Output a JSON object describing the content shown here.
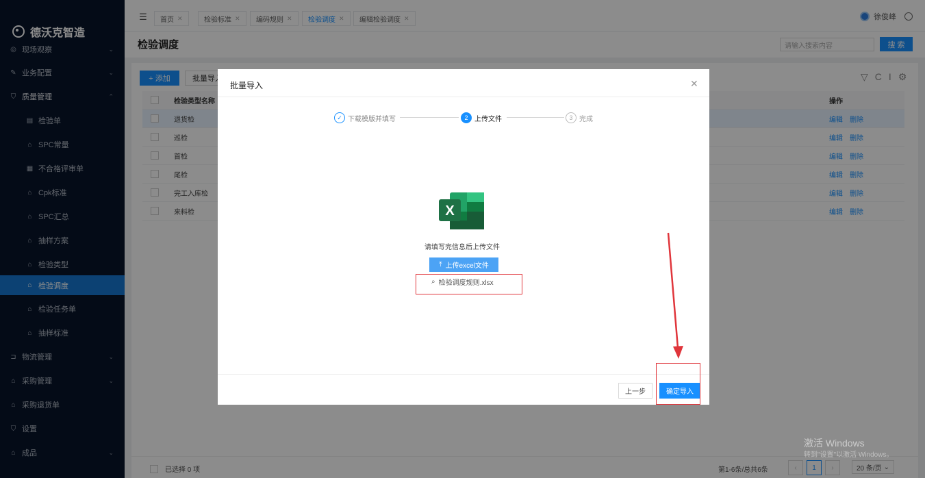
{
  "app": {
    "brand": "德沃克智造"
  },
  "sidebar": {
    "top_item": "现场观察",
    "items": [
      {
        "label": "业务配置",
        "icon": "edit-icon",
        "chevron": "⌄"
      },
      {
        "label": "质量管理",
        "icon": "shield-icon",
        "chevron": "⌃"
      },
      {
        "label": "检验单",
        "icon": "form-icon"
      },
      {
        "label": "SPC常量",
        "icon": "home-icon"
      },
      {
        "label": "不合格评审单",
        "icon": "doc-icon"
      },
      {
        "label": "Cpk标准",
        "icon": "home-icon"
      },
      {
        "label": "SPC汇总",
        "icon": "home-icon"
      },
      {
        "label": "抽样方案",
        "icon": "home-icon"
      },
      {
        "label": "检验类型",
        "icon": "home-icon"
      },
      {
        "label": "检验调度",
        "icon": "home-icon"
      },
      {
        "label": "检验任务单",
        "icon": "home-icon"
      },
      {
        "label": "抽样标准",
        "icon": "home-icon"
      },
      {
        "label": "物流管理",
        "icon": "box-icon",
        "chevron": "⌄"
      },
      {
        "label": "采购管理",
        "icon": "home-icon",
        "chevron": "⌄"
      },
      {
        "label": "采购退货单",
        "icon": "home-icon"
      },
      {
        "label": "设置",
        "icon": "shield-icon"
      },
      {
        "label": "成品",
        "icon": "home-icon",
        "chevron": "⌄"
      }
    ]
  },
  "tabs": [
    {
      "label": "首页"
    },
    {
      "label": "检验标准"
    },
    {
      "label": "编码规则"
    },
    {
      "label": "检验调度",
      "active": true
    },
    {
      "label": "编辑检验调度"
    }
  ],
  "user": {
    "name": "徐俊峰"
  },
  "page": {
    "title": "检验调度",
    "search_placeholder": "请输入搜索内容",
    "search_button": "搜 索",
    "add_button": "+ 添加",
    "batch_button": "批量导入"
  },
  "table": {
    "headers": {
      "name": "检验类型名称",
      "ops": "操作"
    },
    "rows": [
      {
        "name": "退货检"
      },
      {
        "name": "巡检"
      },
      {
        "name": "首检"
      },
      {
        "name": "尾检"
      },
      {
        "name": "完工入库检"
      },
      {
        "name": "来料检"
      }
    ],
    "edit_label": "编辑",
    "delete_label": "删除"
  },
  "footer": {
    "selected": "已选择 0 项",
    "summary": "第1-6条/总共6条",
    "current_page": "1",
    "page_size": "20 条/页"
  },
  "watermark": {
    "line1": "激活 Windows",
    "line2": "转到\"设置\"以激活 Windows。"
  },
  "modal": {
    "title": "批量导入",
    "steps": [
      {
        "label": "下载模版并填写",
        "marker": "✓"
      },
      {
        "label": "上传文件",
        "marker": "2"
      },
      {
        "label": "完成",
        "marker": "3"
      }
    ],
    "hint": "请填写完信息后上传文件",
    "upload_button": "上传excel文件",
    "file_name": "检验调度规则.xlsx",
    "prev_button": "上一步",
    "confirm_button": "确定导入"
  },
  "colors": {
    "primary": "#1890ff",
    "sidebar_bg": "#08152b",
    "highlight": "#e0353b",
    "excel_green": "#1e7145"
  }
}
